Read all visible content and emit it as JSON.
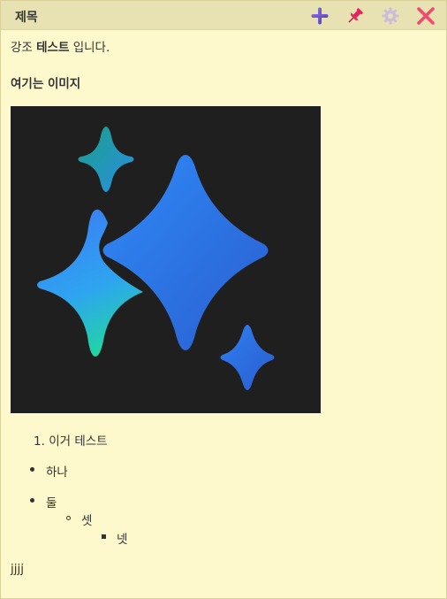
{
  "window": {
    "title": "제목",
    "buttons": {
      "add": "add-icon",
      "pin": "pin-icon",
      "settings": "gear-icon",
      "close": "close-icon"
    }
  },
  "content": {
    "para1": {
      "prefix": "강조 ",
      "bold": "테스트",
      "suffix": " 입니다."
    },
    "heading": "여기는 이미지",
    "image": {
      "icon": "sparkle-icon",
      "background": "#1f1f1f"
    },
    "ordered_list": [
      {
        "number": "1.",
        "text": "이거 테스트"
      }
    ],
    "bullet_list": [
      {
        "text": "하나"
      },
      {
        "text": "둘",
        "children": [
          {
            "text": "셋",
            "children": [
              {
                "text": "넷"
              }
            ]
          }
        ]
      }
    ],
    "footer_text": "jjjj"
  },
  "colors": {
    "note_background": "#fef9cd",
    "titlebar": "#e8e1b2",
    "add": "#6b52c8",
    "pin": "#e0245e",
    "gear": "#c9b8d8",
    "close": "#f04a6e"
  }
}
